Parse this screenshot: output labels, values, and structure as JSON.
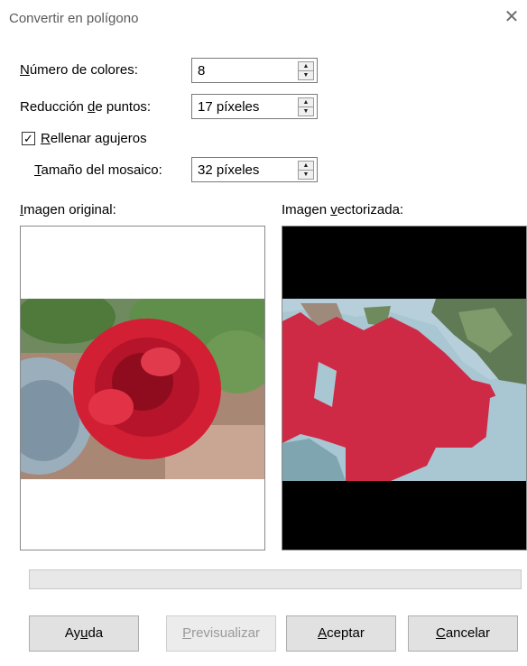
{
  "window": {
    "title": "Convertir en polígono",
    "close_glyph": "✕"
  },
  "fields": {
    "num_colors": {
      "label_u": "N",
      "label_rest": "úmero de colores:",
      "value": "8"
    },
    "point_reduction": {
      "label_pre": "Reducción ",
      "label_u": "d",
      "label_rest": "e puntos:",
      "value": "17 píxeles"
    },
    "fill_holes": {
      "checked": true,
      "check_glyph": "✓",
      "label_u": "R",
      "label_rest": "ellenar agujeros"
    },
    "tile_size": {
      "label_u": "T",
      "label_rest": "amaño del mosaico:",
      "value": "32 píxeles"
    }
  },
  "previews": {
    "original_label_u": "I",
    "original_label_rest": "magen original:",
    "vectorized_label_pre": "Imagen ",
    "vectorized_label_u": "v",
    "vectorized_label_rest": "ectorizada:"
  },
  "buttons": {
    "help_pre": "Ay",
    "help_u": "u",
    "help_post": "da",
    "preview_u": "P",
    "preview_rest": "revisualizar",
    "ok_u": "A",
    "ok_rest": "ceptar",
    "cancel_u": "C",
    "cancel_rest": "ancelar"
  },
  "colors": {
    "rose": "#d4263a",
    "leaf": "#5a8a4a",
    "vec_red": "#cf2a45",
    "vec_blue": "#a9c6d3",
    "vec_green": "#5f7a55"
  }
}
